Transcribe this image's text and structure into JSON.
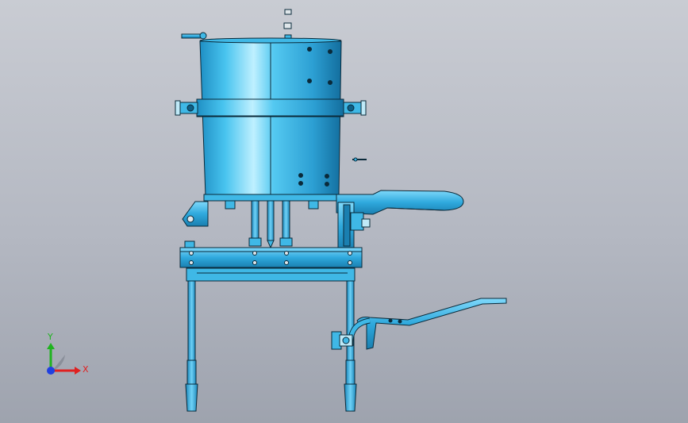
{
  "viewport": {
    "background_top": "#c9ccd3",
    "background_bottom": "#9ea3ae"
  },
  "model": {
    "part_color": "#3fb8e6",
    "part_highlight": "#8fe0ff",
    "part_shadow": "#0e5f86",
    "edge_color": "#0a2a3a"
  },
  "triad": {
    "x_label": "X",
    "y_label": "Y",
    "x_color": "#e02020",
    "y_color": "#1fb31f",
    "z_color": "#2040e0"
  }
}
